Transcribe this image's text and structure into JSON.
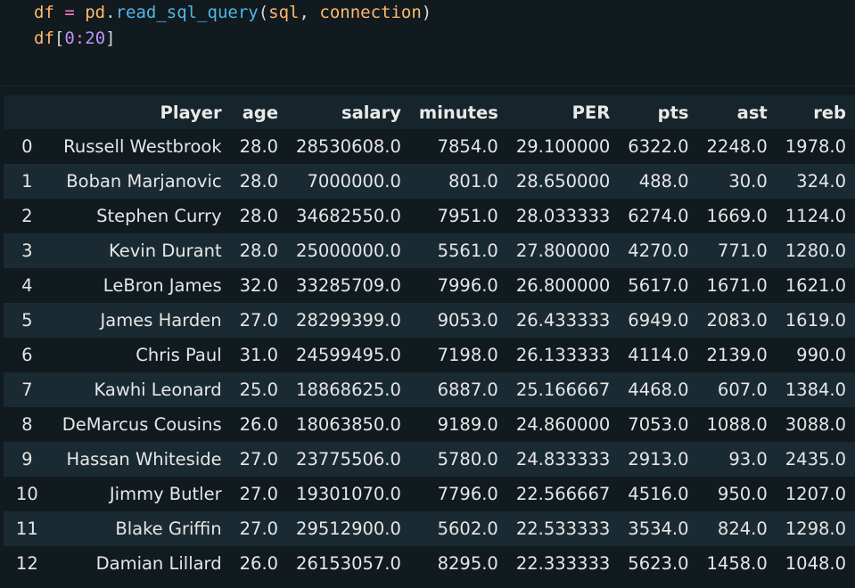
{
  "code": {
    "line1": {
      "var": "df",
      "op": " = ",
      "module": "pd",
      "dot": ".",
      "func": "read_sql_query",
      "open": "(",
      "arg1": "sql",
      "comma": ", ",
      "arg2": "connection",
      "close": ")"
    },
    "line2": {
      "var": "df",
      "open": "[",
      "start": "0",
      "colon": ":",
      "end": "20",
      "close": "]"
    }
  },
  "table": {
    "columns": [
      "",
      "Player",
      "age",
      "salary",
      "minutes",
      "PER",
      "pts",
      "ast",
      "reb"
    ],
    "rows": [
      [
        "0",
        "Russell Westbrook",
        "28.0",
        "28530608.0",
        "7854.0",
        "29.100000",
        "6322.0",
        "2248.0",
        "1978.0"
      ],
      [
        "1",
        "Boban Marjanovic",
        "28.0",
        "7000000.0",
        "801.0",
        "28.650000",
        "488.0",
        "30.0",
        "324.0"
      ],
      [
        "2",
        "Stephen Curry",
        "28.0",
        "34682550.0",
        "7951.0",
        "28.033333",
        "6274.0",
        "1669.0",
        "1124.0"
      ],
      [
        "3",
        "Kevin Durant",
        "28.0",
        "25000000.0",
        "5561.0",
        "27.800000",
        "4270.0",
        "771.0",
        "1280.0"
      ],
      [
        "4",
        "LeBron James",
        "32.0",
        "33285709.0",
        "7996.0",
        "26.800000",
        "5617.0",
        "1671.0",
        "1621.0"
      ],
      [
        "5",
        "James Harden",
        "27.0",
        "28299399.0",
        "9053.0",
        "26.433333",
        "6949.0",
        "2083.0",
        "1619.0"
      ],
      [
        "6",
        "Chris Paul",
        "31.0",
        "24599495.0",
        "7198.0",
        "26.133333",
        "4114.0",
        "2139.0",
        "990.0"
      ],
      [
        "7",
        "Kawhi Leonard",
        "25.0",
        "18868625.0",
        "6887.0",
        "25.166667",
        "4468.0",
        "607.0",
        "1384.0"
      ],
      [
        "8",
        "DeMarcus Cousins",
        "26.0",
        "18063850.0",
        "9189.0",
        "24.860000",
        "7053.0",
        "1088.0",
        "3088.0"
      ],
      [
        "9",
        "Hassan Whiteside",
        "27.0",
        "23775506.0",
        "5780.0",
        "24.833333",
        "2913.0",
        "93.0",
        "2435.0"
      ],
      [
        "10",
        "Jimmy Butler",
        "27.0",
        "19301070.0",
        "7796.0",
        "22.566667",
        "4516.0",
        "950.0",
        "1207.0"
      ],
      [
        "11",
        "Blake Griffin",
        "27.0",
        "29512900.0",
        "5602.0",
        "22.533333",
        "3534.0",
        "824.0",
        "1298.0"
      ],
      [
        "12",
        "Damian Lillard",
        "26.0",
        "26153057.0",
        "8295.0",
        "22.333333",
        "5623.0",
        "1458.0",
        "1048.0"
      ]
    ]
  },
  "colors": {
    "background": "#111a1f",
    "row_alt": "#1a2a32",
    "header_bg": "#16242b",
    "text": "#e6e6e6"
  }
}
